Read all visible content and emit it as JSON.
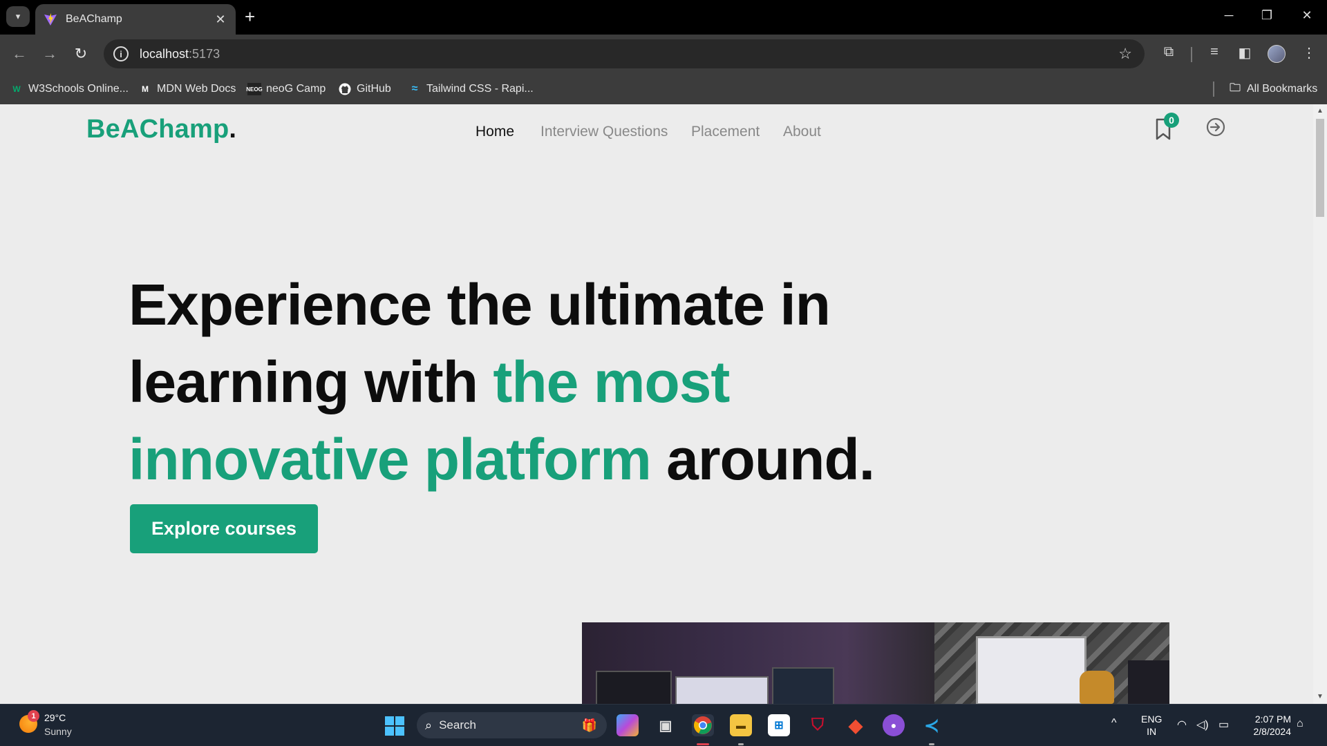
{
  "browser": {
    "tab_title": "BeAChamp",
    "url_host": "localhost",
    "url_port": ":5173",
    "bookmarks": [
      {
        "label": "W3Schools Online...",
        "icon": "w3schools-icon"
      },
      {
        "label": "MDN Web Docs",
        "icon": "mdn-icon"
      },
      {
        "label": "neoG Camp",
        "icon": "neog-icon"
      },
      {
        "label": "GitHub",
        "icon": "github-icon"
      },
      {
        "label": "Tailwind CSS - Rapi...",
        "icon": "tailwind-icon"
      }
    ],
    "all_bookmarks": "All Bookmarks"
  },
  "site": {
    "logo": "BeAChamp",
    "logo_dot": ".",
    "nav": [
      "Home",
      "Interview Questions",
      "Placement",
      "About"
    ],
    "active_nav": "Home",
    "bookmark_count": "0",
    "hero": {
      "part1": "Experience the ultimate in learning with ",
      "highlight": "the most innovative platform",
      "part2": " around."
    },
    "cta": "Explore courses",
    "accent_color": "#18a07a"
  },
  "taskbar": {
    "weather_badge": "1",
    "temperature": "29°C",
    "condition": "Sunny",
    "search_placeholder": "Search",
    "language": "ENG",
    "region": "IN",
    "time": "2:07 PM",
    "date": "2/8/2024",
    "apps": [
      "copilot-icon",
      "task-view-icon",
      "chrome-icon",
      "file-explorer-icon",
      "microsoft-store-icon",
      "mcafee-icon",
      "git-icon",
      "github-desktop-icon",
      "vscode-icon"
    ]
  }
}
